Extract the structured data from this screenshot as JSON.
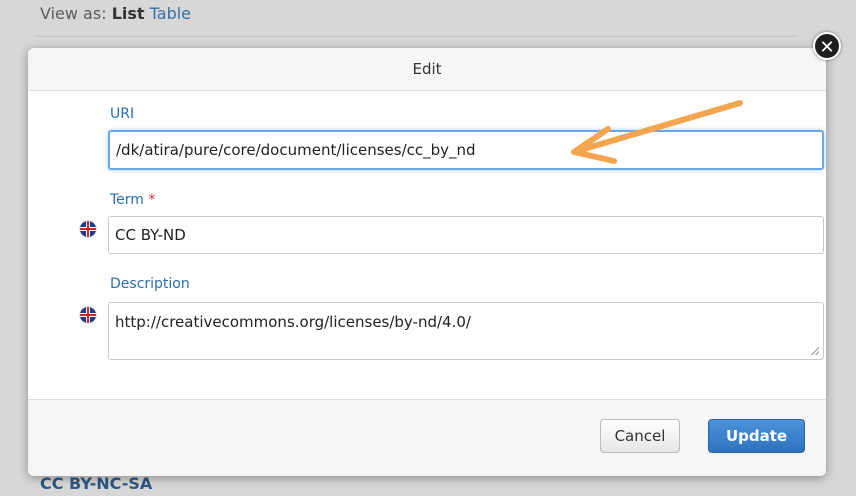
{
  "background": {
    "view_as_label": "View as:",
    "view_list": "List",
    "view_table": "Table",
    "bottom_link": "CC BY-NC-SA"
  },
  "dialog": {
    "title": "Edit",
    "close_glyph": "✕",
    "uri": {
      "label": "URI",
      "value": "/dk/atira/pure/core/document/licenses/cc_by_nd"
    },
    "term": {
      "label": "Term",
      "required_mark": "*",
      "value": "CC BY-ND"
    },
    "description": {
      "label": "Description",
      "value": "http://creativecommons.org/licenses/by-nd/4.0/"
    },
    "cancel_label": "Cancel",
    "update_label": "Update"
  },
  "colors": {
    "accent": "#2a6db3",
    "annotation_arrow": "#f4a54f",
    "update_button": "#3a80cc",
    "required": "#d2313a"
  },
  "icons": [
    "close-icon",
    "uk-flag-icon",
    "resize-grip-icon",
    "annotation-arrow"
  ]
}
